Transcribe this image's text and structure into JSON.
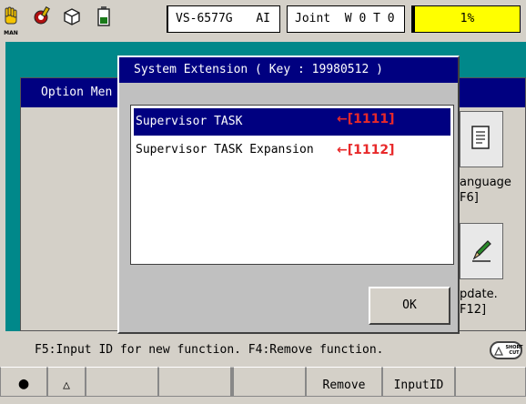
{
  "topbar": {
    "man_label": "MAN",
    "robot_model": "VS-6577G",
    "mode_ai": "AI",
    "coord_status": "Joint  W 0 T 0",
    "speed": "1%",
    "icons": [
      "hand-man-icon",
      "tool-icon",
      "cube-icon",
      "battery-icon"
    ]
  },
  "option_menu": {
    "title": "Option Men",
    "side_buttons": [
      {
        "icon": "document-icon",
        "label_line1": "anguage",
        "label_line2": "F6]"
      },
      {
        "icon": "pencil-icon",
        "label_line1": "pdate.",
        "label_line2": "F12]"
      }
    ]
  },
  "dialog": {
    "title": "System Extension ( Key : 19980512 )",
    "items": [
      {
        "label": "Supervisor TASK",
        "annotation": "←[1111]",
        "selected": true
      },
      {
        "label": "Supervisor TASK Expansion",
        "annotation": "←[1112]",
        "selected": false
      }
    ],
    "ok_label": "OK"
  },
  "status_message": "F5:Input ID for new function. F4:Remove function.",
  "shortcut_button": {
    "line1": "SHORT",
    "line2": "CUT"
  },
  "function_keys": [
    {
      "label": "●"
    },
    {
      "label": "△"
    },
    {
      "label": ""
    },
    {
      "label": ""
    },
    {
      "label": ""
    },
    {
      "label": ""
    },
    {
      "label": "Remove"
    },
    {
      "label": "InputID"
    },
    {
      "label": ""
    }
  ],
  "colors": {
    "title_bar": "#000080",
    "workspace": "#00888a",
    "speed_indicator": "#ffff00",
    "annotation": "#e8292a"
  }
}
